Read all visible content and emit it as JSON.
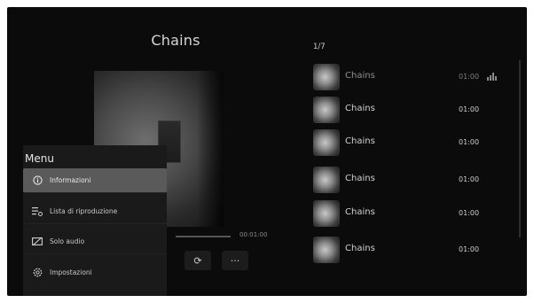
{
  "player": {
    "title": "Chains",
    "time_end": "00:01:00",
    "controls": [
      {
        "name": "repeat-icon",
        "glyph": "⟳"
      },
      {
        "name": "more-icon",
        "glyph": "···"
      }
    ]
  },
  "menu": {
    "title": "Menu",
    "items": [
      {
        "label": "Informazioni",
        "icon": "info-icon",
        "active": true
      },
      {
        "label": "Lista di riproduzione",
        "icon": "playlist-icon",
        "active": false
      },
      {
        "label": "Solo audio",
        "icon": "audio-only-icon",
        "active": false
      },
      {
        "label": "Impostazioni",
        "icon": "settings-icon",
        "active": false
      }
    ]
  },
  "playlist": {
    "counter": "1/7",
    "tracks": [
      {
        "name": "Chains",
        "duration": "01:00",
        "playing": true
      },
      {
        "name": "Chains",
        "duration": "01:00",
        "playing": false
      },
      {
        "name": "Chains",
        "duration": "01:00",
        "playing": false
      },
      {
        "name": "Chains",
        "duration": "01:00",
        "playing": false
      },
      {
        "name": "Chains",
        "duration": "01:00",
        "playing": false
      },
      {
        "name": "Chains",
        "duration": "01:00",
        "playing": false
      }
    ]
  }
}
